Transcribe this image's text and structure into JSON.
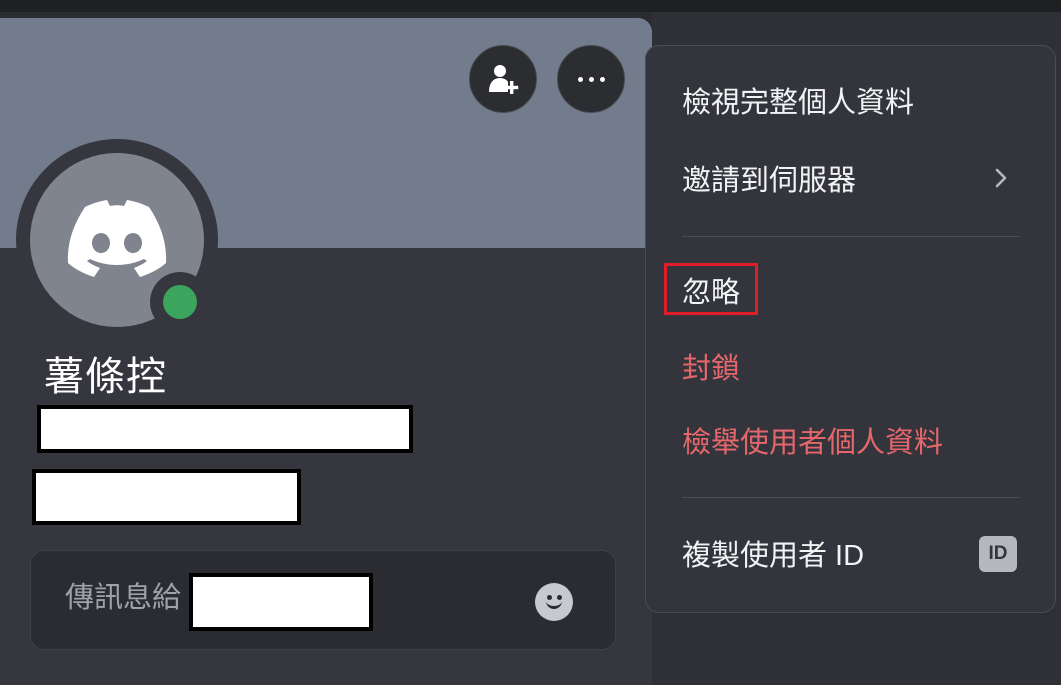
{
  "profile": {
    "display_name": "薯條控",
    "status": "online"
  },
  "header_actions": {
    "add_friend_icon": "add-friend-icon",
    "more_icon": "more-icon"
  },
  "message": {
    "placeholder_prefix": "傳訊息給",
    "emoji_icon": "emoji-icon"
  },
  "menu": {
    "view_profile": "檢視完整個人資料",
    "invite_to_server": "邀請到伺服器",
    "ignore": "忽略",
    "block": "封鎖",
    "report_profile": "檢舉使用者個人資料",
    "copy_user_id": "複製使用者 ID",
    "id_badge": "ID"
  },
  "colors": {
    "banner": "#737c8c",
    "danger": "#e5676b",
    "online": "#3ba55d",
    "highlight": "#e01e2a"
  }
}
